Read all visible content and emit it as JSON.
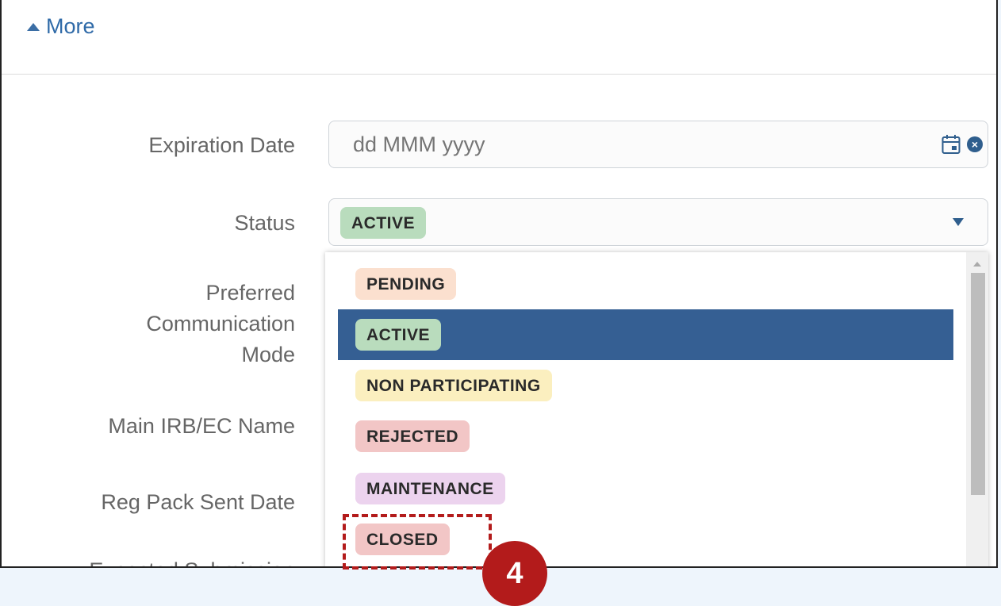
{
  "more_toggle": {
    "label": "More",
    "icon": "caret-up-icon"
  },
  "form": {
    "expiration_date": {
      "label": "Expiration Date",
      "placeholder": "dd MMM yyyy",
      "icons": [
        "calendar-icon",
        "clear-icon"
      ]
    },
    "status": {
      "label": "Status",
      "value": "ACTIVE",
      "value_color": "#b9dcbd"
    },
    "preferred_communication_mode": {
      "label_lines": [
        "Preferred",
        "Communication",
        "Mode"
      ]
    },
    "main_irb_ec_name": {
      "label": "Main IRB/EC Name"
    },
    "reg_pack_sent_date": {
      "label": "Reg Pack Sent Date"
    },
    "expected_submission": {
      "label": "Expected Submission"
    }
  },
  "status_options": [
    {
      "label": "PENDING",
      "color": "#fbe0cf",
      "selected": false
    },
    {
      "label": "ACTIVE",
      "color": "#b9dcbd",
      "selected": true
    },
    {
      "label": "NON PARTICIPATING",
      "color": "#fbefbf",
      "selected": false
    },
    {
      "label": "REJECTED",
      "color": "#f2c6c6",
      "selected": false
    },
    {
      "label": "MAINTENANCE",
      "color": "#ecd3ee",
      "selected": false
    },
    {
      "label": "CLOSED",
      "color": "#f2c6c6",
      "selected": false
    }
  ],
  "selected_option_color": "#355f93",
  "callout": {
    "step": "4",
    "color": "#b31b1b"
  }
}
